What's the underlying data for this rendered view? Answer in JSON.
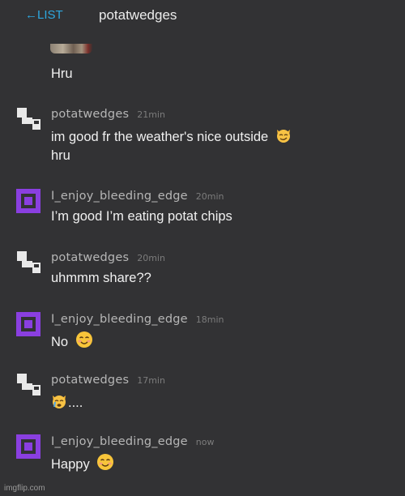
{
  "header": {
    "back_label": "LIST",
    "back_arrow": "←",
    "title": "potatwedges"
  },
  "previous_message_tail": {
    "text": "Hru"
  },
  "messages": [
    {
      "user": "potatwedges",
      "time": "21min",
      "avatar": "identicon-grey",
      "lines": [
        "im good fr the weather's nice outside",
        "hru"
      ],
      "emoji": "smirking-cat-emoji"
    },
    {
      "user": "I_enjoy_bleeding_edge",
      "time": "20min",
      "avatar": "identicon-purple",
      "lines": [
        "I’m good I’m eating potat chips"
      ]
    },
    {
      "user": "potatwedges",
      "time": "20min",
      "avatar": "identicon-grey",
      "lines": [
        "uhmmm share??"
      ]
    },
    {
      "user": "I_enjoy_bleeding_edge",
      "time": "18min",
      "avatar": "identicon-purple",
      "lines": [
        "No"
      ],
      "emoji": "smiling-face-emoji"
    },
    {
      "user": "potatwedges",
      "time": "17min",
      "avatar": "identicon-grey",
      "lines": [
        "...."
      ],
      "emoji": "crying-cat-emoji"
    },
    {
      "user": "I_enjoy_bleeding_edge",
      "time": "now",
      "avatar": "identicon-purple",
      "lines": [
        "Happy"
      ],
      "emoji": "smiling-face-emoji"
    }
  ],
  "colors": {
    "background": "#323234",
    "link": "#2ea8e0",
    "purple_avatar": "#8a3fe0",
    "grey_avatar": "#e9e9e9"
  },
  "footer": {
    "watermark": "imgflip.com"
  }
}
